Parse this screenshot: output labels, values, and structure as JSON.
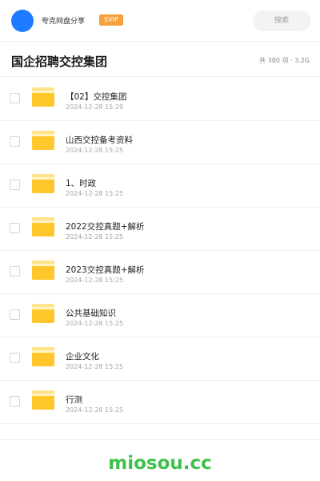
{
  "header": {
    "user_name": "夸克网盘分享",
    "badge": "SVIP",
    "search_placeholder": "搜索"
  },
  "title_bar": {
    "title": "国企招聘交控集团",
    "stats": "共 380 项 · 3.2G"
  },
  "files": [
    {
      "name": "【02】交控集团",
      "date": "2024-12-28 15:29"
    },
    {
      "name": "山西交控备考资料",
      "date": "2024-12-28 15:25"
    },
    {
      "name": "1、时政",
      "date": "2024-12-28 15:25"
    },
    {
      "name": "2022交控真题+解析",
      "date": "2024-12-28 15:25"
    },
    {
      "name": "2023交控真题+解析",
      "date": "2024-12-28 15:25"
    },
    {
      "name": "公共基础知识",
      "date": "2024-12-28 15:25"
    },
    {
      "name": "企业文化",
      "date": "2024-12-28 15:25"
    },
    {
      "name": "行测",
      "date": "2024-12-28 15:25"
    }
  ],
  "footer": {
    "watermark": "miosou.cc"
  },
  "colors": {
    "avatar": "#1f7bff",
    "badge": "#f6a23c",
    "folder": "#ffc72c",
    "watermark": "#3ec14a"
  }
}
